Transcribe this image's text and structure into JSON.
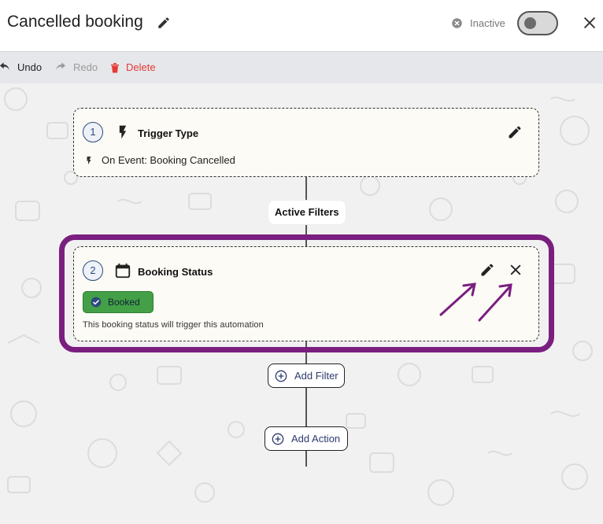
{
  "header": {
    "title": "Cancelled booking",
    "status_label": "Inactive",
    "toggle_on": false
  },
  "toolbar": {
    "undo_label": "Undo",
    "redo_label": "Redo",
    "delete_label": "Delete"
  },
  "trigger": {
    "step": "1",
    "title": "Trigger Type",
    "event": "On Event: Booking Cancelled"
  },
  "filters_label": "Active Filters",
  "filter": {
    "step": "2",
    "title": "Booking Status",
    "chip_label": "Booked",
    "helper": "This booking status will trigger this automation"
  },
  "add_filter_label": "Add Filter",
  "add_action_label": "Add Action",
  "colors": {
    "highlight": "#7a1e80",
    "delete": "#e53935",
    "chip": "#43a047",
    "step_accent": "#2c4a7a"
  }
}
